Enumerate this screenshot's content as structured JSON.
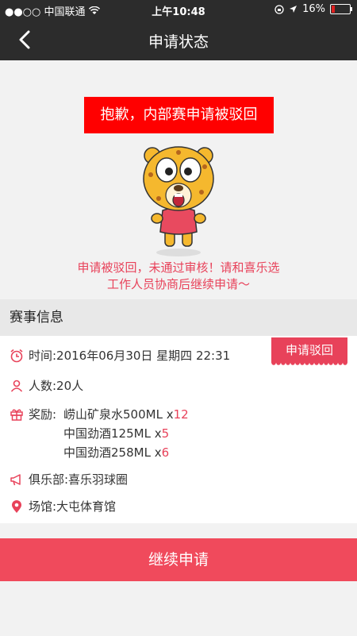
{
  "status_bar": {
    "carrier": "●●○○ 中国联通",
    "time": "上午10:48",
    "battery_text": "16%",
    "battery_level": 0.16
  },
  "navbar": {
    "title": "申请状态"
  },
  "rejection": {
    "banner": "抱歉，内部赛申请被驳回",
    "message_line1": "申请被驳回，未通过审核！请和喜乐选",
    "message_line2": "工作人员协商后继续申请～"
  },
  "event_info": {
    "section_title": "赛事信息",
    "status_tag": "申请驳回",
    "time": "时间:2016年06月30日 星期四 22:31",
    "people": "人数:20人",
    "reward_label": "奖励:",
    "rewards": [
      {
        "name": "崂山矿泉水500ML x",
        "qty": "12"
      },
      {
        "name": "中国劲酒125ML x",
        "qty": "5"
      },
      {
        "name": "中国劲酒258ML x",
        "qty": "6"
      }
    ],
    "club": "俱乐部:喜乐羽球圈",
    "venue": "场馆:大屯体育馆"
  },
  "actions": {
    "continue_label": "继续申请"
  },
  "colors": {
    "accent": "#e8425a",
    "banner_red": "#ff0000",
    "bar_dark": "#2c2c2c"
  }
}
